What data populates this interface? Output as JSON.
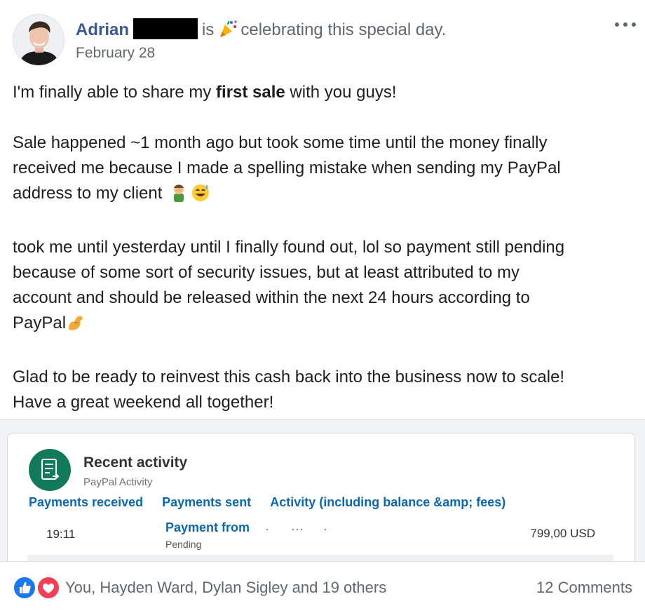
{
  "post": {
    "author_first": "Adrian",
    "activity_before": "is",
    "activity_after": "celebrating this special day.",
    "date": "February 28",
    "body": {
      "p1_before": "I'm finally able to share my ",
      "p1_bold": "first sale",
      "p1_after": " with you guys!",
      "p2_line1": "Sale happened ~1 month ago but took some time until the money finally",
      "p2_line2": "received me because I made a spelling mistake when sending my PayPal",
      "p2_line3": "address to my client",
      "p3_line1": "took me until yesterday until I finally found out, lol so payment still pending",
      "p3_line2": "because of some sort of security issues, but at least attributed to my",
      "p3_line3": "account and should be released within the next 24 hours according to",
      "p3_line4": "PayPal",
      "p4_line1": "Glad to be ready to reinvest this cash back into the business now to scale!",
      "p4_line2": "Have a great weekend all together!"
    },
    "icons": {
      "party": "party-popper-icon",
      "emoji_1": "facepalm-emoji-icon",
      "emoji_2": "grinning-sweat-emoji-icon",
      "emoji_3": "flexed-biceps-emoji-icon"
    }
  },
  "attachment": {
    "title": "Recent activity",
    "subtitle": "PayPal Activity",
    "tabs": [
      "Payments received",
      "Payments sent",
      "Activity (including balance &amp; fees)"
    ],
    "row": {
      "time": "19:11",
      "description": "Payment from",
      "status": "Pending",
      "amount": "799,00 USD"
    },
    "colors": {
      "brand": "#127a5a",
      "link": "#0c68b2"
    }
  },
  "footer": {
    "reactions_text": "You, Hayden Ward, Dylan Sigley and 19 others",
    "comments": "12 Comments",
    "colors": {
      "like": "#1877f2",
      "love": "#f33e58"
    }
  }
}
